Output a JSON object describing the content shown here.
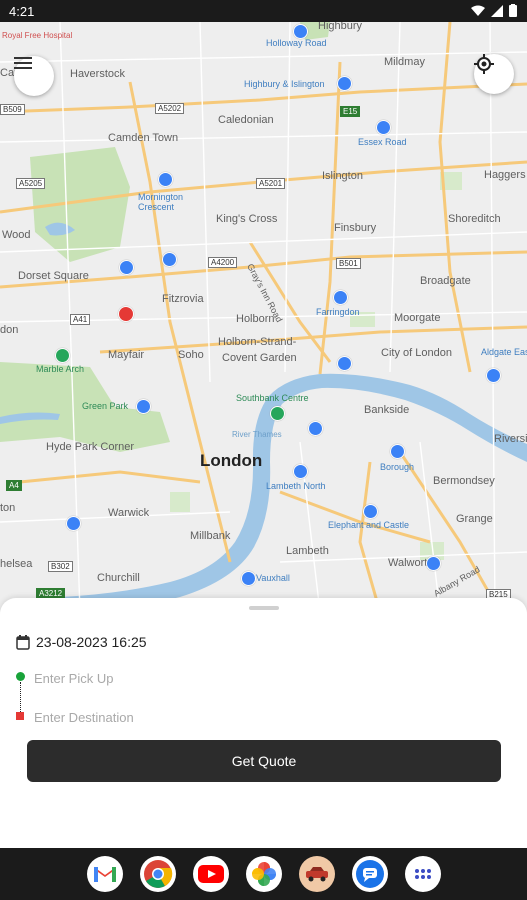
{
  "status_bar": {
    "time": "4:21"
  },
  "map": {
    "labels": {
      "royal_free": "Royal Free Hospital",
      "camden": "Camden",
      "haverstock": "Haverstock",
      "highbury": "Highbury",
      "holloway_road": "Holloway Road",
      "mildmay": "Mildmay",
      "highbury_islington": "Highbury & Islington",
      "caledonian": "Caledonian",
      "camden_town": "Camden Town",
      "essex_road": "Essex Road",
      "haggers": "Haggers",
      "mornington_crescent": "Mornington Crescent",
      "islington": "Islington",
      "wood": "Wood",
      "kings_cross": "King's Cross",
      "finsbury": "Finsbury",
      "shoreditch": "Shoreditch",
      "dorset_square": "Dorset Square",
      "grays_inn_road": "Gray's Inn Road",
      "broadgate": "Broadgate",
      "fitzrovia": "Fitzrovia",
      "farringdon": "Farringdon",
      "holborn": "Holborn",
      "moorgate": "Moorgate",
      "mayfair": "Mayfair",
      "soho": "Soho",
      "holborn_strand": "Holborn-Strand-",
      "covent_garden": "Covent Garden",
      "city_of_london": "City of London",
      "aldgate_east": "Aldgate East",
      "marble_arch": "Marble Arch",
      "southbank_centre": "Southbank Centre",
      "bankside": "Bankside",
      "green_park": "Green Park",
      "river_thames": "River Thames",
      "riverside": "Riverside",
      "hyde_park_corner": "Hyde Park Corner",
      "borough": "Borough",
      "london": "London",
      "bermondsey": "Bermondsey",
      "lambeth_north": "Lambeth North",
      "ton": "ton",
      "warwick": "Warwick",
      "grange": "Grange",
      "millbank": "Millbank",
      "elephant_castle": "Elephant and Castle",
      "lambeth": "Lambeth",
      "walworth": "Walworth",
      "chelsea": "helsea",
      "churchill": "Churchill",
      "vauxhall": "Vauxhall",
      "old_kent_road": "Albany Road",
      "don": "don"
    },
    "road_codes": {
      "b509": "B509",
      "a5202": "A5202",
      "e15": "E15",
      "a5205": "A5205",
      "a5201": "A5201",
      "a4200": "A4200",
      "b501": "B501",
      "a41": "A41",
      "a4": "A4",
      "b302": "B302",
      "a3212": "A3212",
      "b215": "B215"
    }
  },
  "sheet": {
    "datetime": "23-08-2023 16:25",
    "pickup_placeholder": "Enter Pick Up",
    "destination_placeholder": "Enter Destination",
    "quote_button": "Get Quote"
  },
  "dock": {
    "apps": [
      "Gmail",
      "Chrome",
      "YouTube",
      "Photos",
      "Taxi App",
      "Messages",
      "App Drawer"
    ]
  },
  "colors": {
    "water": "#9fc6e6",
    "park": "#c8e2b6",
    "road_major": "#f6c97a",
    "button_dark": "#2c2c2c",
    "pickup_green": "#19a33a",
    "destination_red": "#e53935"
  }
}
